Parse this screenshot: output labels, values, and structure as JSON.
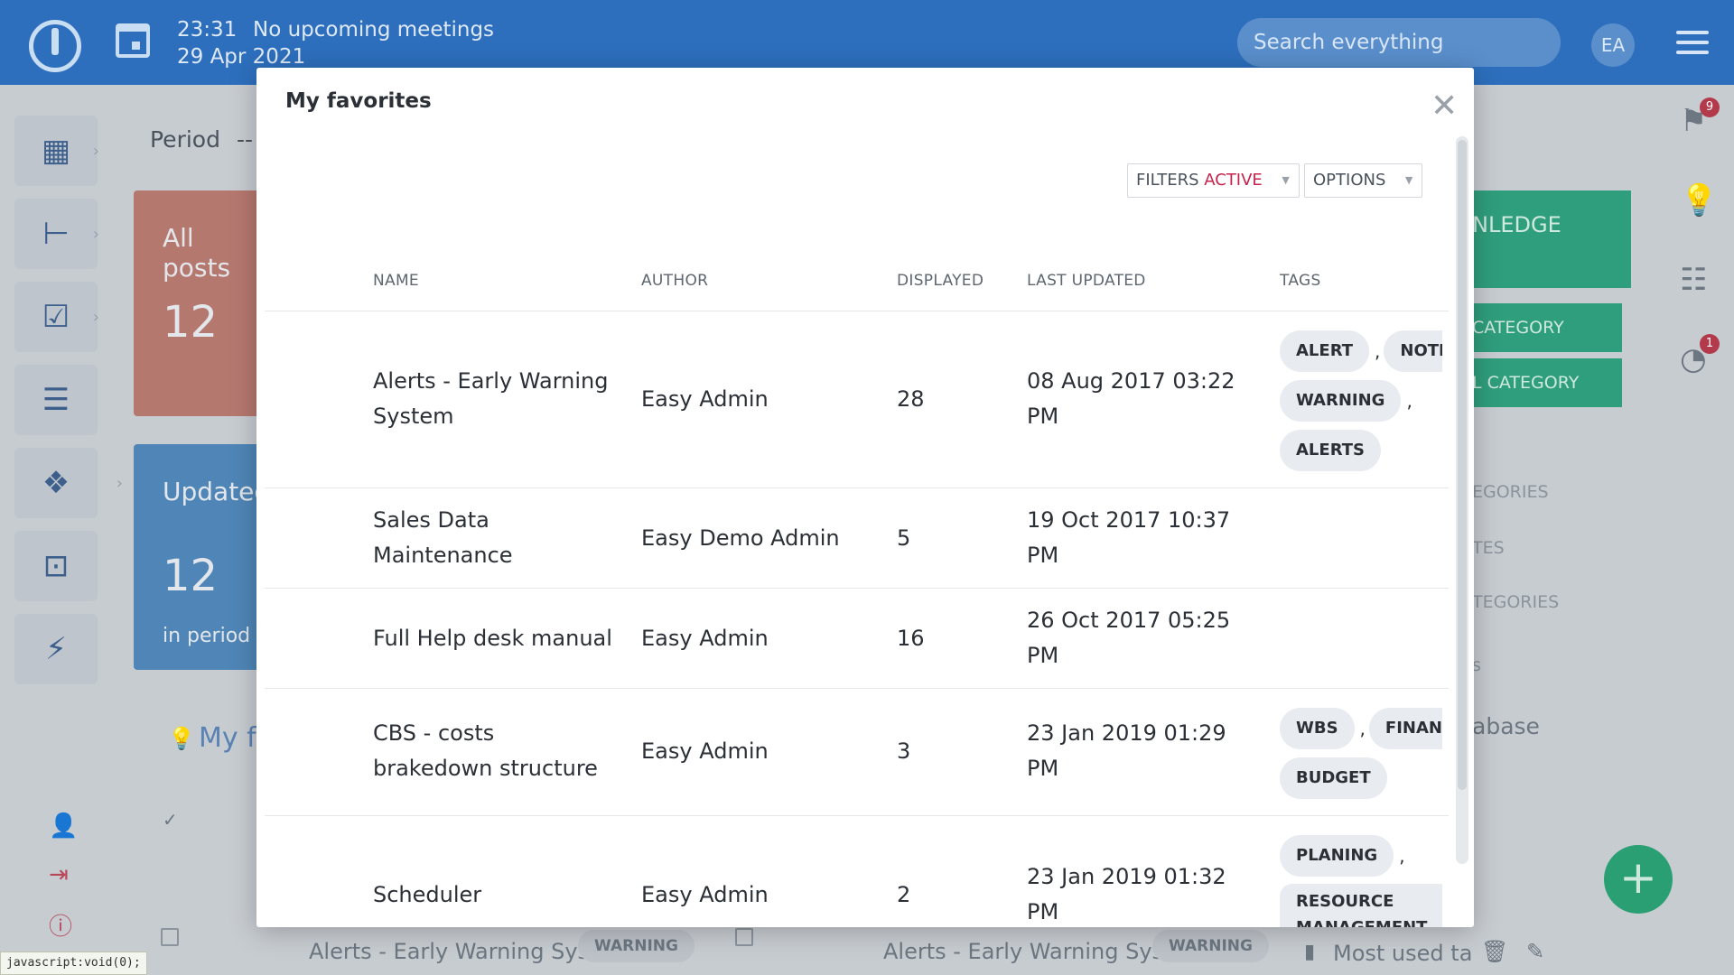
{
  "header": {
    "time": "23:31",
    "meetings": "No upcoming meetings",
    "date": "29 Apr 2021",
    "search_placeholder": "Search everything",
    "avatar_initials": "EA"
  },
  "right_sidebar": {
    "flag_badge": "9",
    "timer_badge": "1"
  },
  "background": {
    "period_label": "Period",
    "period_value": "--",
    "card1_title": "All posts",
    "card1_value": "12",
    "card2_title": "Updated",
    "card2_value": "12",
    "card2_sub": "in period",
    "my_favorites_partial": "My f",
    "knowledge_partial": "NLEDGE",
    "category1": "CATEGORY",
    "category2": "L CATEGORY",
    "list1": "EGORIES",
    "list2": "TES",
    "list3": "TEGORIES",
    "list4": "s",
    "database_partial": "abase",
    "row_title": "Alerts - Early Warning System",
    "row_tag": "WARNING",
    "most_used": "Most used ta"
  },
  "modal": {
    "title": "My favorites",
    "filters_label": "FILTERS",
    "filters_state": "ACTIVE",
    "options_label": "OPTIONS",
    "columns": [
      "NAME",
      "AUTHOR",
      "DISPLAYED",
      "LAST UPDATED",
      "TAGS"
    ],
    "rows": [
      {
        "name_l1": "Alerts - Early Warning",
        "name_l2": "System",
        "author": "Easy Admin",
        "displayed": "28",
        "updated_l1": "08 Aug 2017 03:22",
        "updated_l2": "PM",
        "tags": [
          "ALERT",
          "NOTICE",
          "WARNING",
          "ALERTS"
        ]
      },
      {
        "name_l1": "Sales Data",
        "name_l2": "Maintenance",
        "author": "Easy Demo Admin",
        "displayed": "5",
        "updated_l1": "19 Oct 2017 10:37",
        "updated_l2": "PM",
        "tags": []
      },
      {
        "name_l1": "Full Help desk manual",
        "name_l2": "",
        "author": "Easy Admin",
        "displayed": "16",
        "updated_l1": "26 Oct 2017 05:25",
        "updated_l2": "PM",
        "tags": []
      },
      {
        "name_l1": "CBS - costs",
        "name_l2": "brakedown structure",
        "author": "Easy Admin",
        "displayed": "3",
        "updated_l1": "23 Jan 2019 01:29",
        "updated_l2": "PM",
        "tags": [
          "WBS",
          "FINANCE",
          "BUDGET"
        ]
      },
      {
        "name_l1": "Scheduler",
        "name_l2": "",
        "author": "Easy Admin",
        "displayed": "2",
        "updated_l1": "23 Jan 2019 01:32",
        "updated_l2": "PM",
        "tags": [
          "PLANING",
          "RESOURCE MANAGEMENT"
        ]
      }
    ]
  },
  "status_bar": "javascript:void(0);",
  "colors": {
    "header": "#2d6fbd",
    "active_filter": "#c7234d",
    "green_card": "#2f9e7c",
    "fab": "#2a9f73"
  }
}
